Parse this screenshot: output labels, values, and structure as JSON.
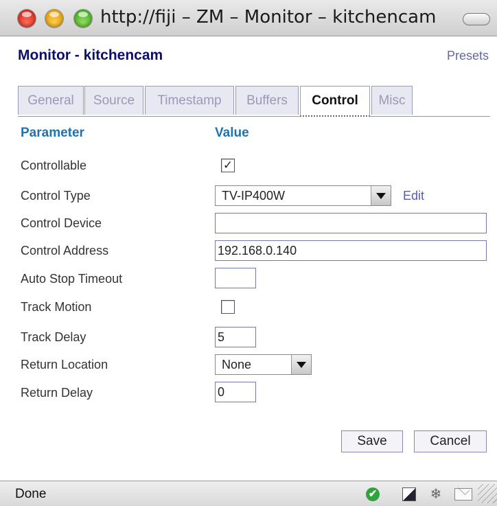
{
  "window": {
    "title": "http://fiji – ZM – Monitor – kitchencam"
  },
  "header": {
    "title": "Monitor - kitchencam",
    "presets_label": "Presets"
  },
  "tabs": [
    {
      "label": "General",
      "active": false
    },
    {
      "label": "Source",
      "active": false
    },
    {
      "label": "Timestamp",
      "active": false
    },
    {
      "label": "Buffers",
      "active": false
    },
    {
      "label": "Control",
      "active": true
    },
    {
      "label": "Misc",
      "active": false
    }
  ],
  "table": {
    "param_header": "Parameter",
    "value_header": "Value",
    "rows": {
      "controllable": {
        "label": "Controllable",
        "checked": true,
        "check_glyph": "✓"
      },
      "control_type": {
        "label": "Control Type",
        "value": "TV-IP400W",
        "edit_label": "Edit"
      },
      "control_device": {
        "label": "Control Device",
        "value": ""
      },
      "control_address": {
        "label": "Control Address",
        "value": "192.168.0.140"
      },
      "auto_stop_timeout": {
        "label": "Auto Stop Timeout",
        "value": ""
      },
      "track_motion": {
        "label": "Track Motion",
        "checked": false
      },
      "track_delay": {
        "label": "Track Delay",
        "value": "5"
      },
      "return_location": {
        "label": "Return Location",
        "value": "None"
      },
      "return_delay": {
        "label": "Return Delay",
        "value": "0"
      }
    }
  },
  "actions": {
    "save_label": "Save",
    "cancel_label": "Cancel"
  },
  "statusbar": {
    "text": "Done",
    "ok_glyph": "✔",
    "flake_glyph": "❄"
  },
  "colors": {
    "title": "#0d0d6b",
    "header": "#1d74b0",
    "link": "#5a5aa8",
    "tab_border": "#9999bb"
  }
}
